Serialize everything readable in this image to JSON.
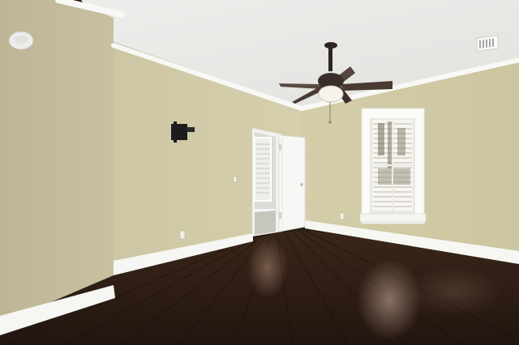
{
  "scene": {
    "subject": "empty room",
    "colors": {
      "ceiling": "#e9e9e7",
      "wall_left": "#c4bd9c",
      "wall_back": "#d2cba8",
      "wall_right": "#d6cfab",
      "trim": "#f7f7f4",
      "floor_dark": "#2a1a12",
      "floor_mid": "#4a3022",
      "floor_light": "#7a5a48",
      "fan_dark": "#3a2e2a",
      "window_light": "#f4f3ee"
    },
    "elements": [
      "ceiling",
      "ceiling-fan",
      "light-fixture",
      "air-vent",
      "smoke-detector",
      "tv-wall-mount",
      "open-doorway",
      "open-door",
      "window-with-shutters",
      "baseboard",
      "crown-molding",
      "hardwood-floor",
      "electrical-outlet"
    ]
  }
}
